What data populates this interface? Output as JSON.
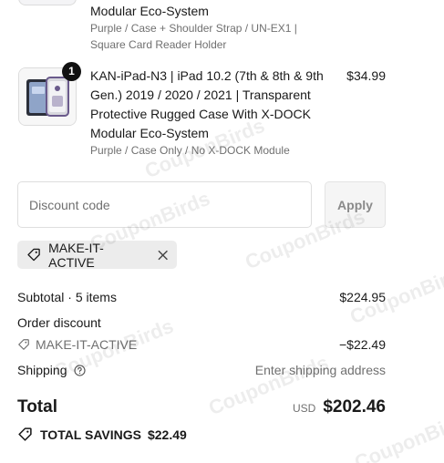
{
  "previous_item": {
    "title": "Modular Eco-System",
    "variant": "Purple / Case + Shoulder Strap / UN-EX1 | Square Card Reader Holder"
  },
  "item": {
    "quantity_badge": "1",
    "title": "KAN-iPad-N3 | iPad 10.2 (7th & 8th & 9th Gen.) 2019 / 2020 / 2021 | Transparent Protective Rugged Case With X-DOCK Modular Eco-System",
    "variant": "Purple / Case Only / No X-DOCK Module",
    "price": "$34.99"
  },
  "discount": {
    "placeholder": "Discount code",
    "apply_label": "Apply",
    "applied_code": "MAKE-IT-ACTIVE"
  },
  "summary": {
    "subtotal_label": "Subtotal · 5 items",
    "subtotal_value": "$224.95",
    "order_discount_label": "Order discount",
    "code_label": "MAKE-IT-ACTIVE",
    "code_value": "−$22.49",
    "shipping_label": "Shipping",
    "shipping_value": "Enter shipping address",
    "total_label": "Total",
    "currency": "USD",
    "total_value": "$202.46",
    "savings_label": "TOTAL SAVINGS",
    "savings_value": "$22.49"
  },
  "watermark": "CouponBirds",
  "icons": {
    "tag": "tag-icon",
    "close": "close-icon",
    "help": "help-circle-icon"
  }
}
